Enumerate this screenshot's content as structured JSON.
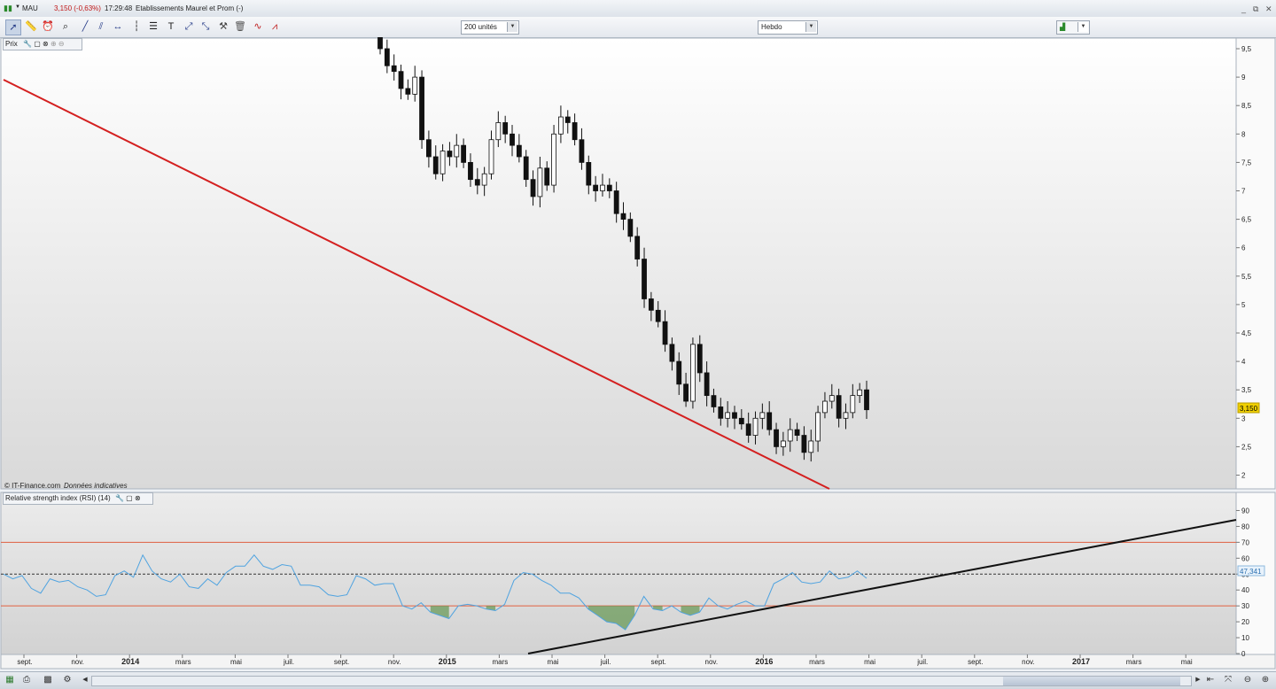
{
  "header": {
    "ticker": "MAU",
    "price_change": "3,150 (-0,63%)",
    "time": "17:29:48",
    "company": "Etablissements Maurel et Prom (-)"
  },
  "toolbar": {
    "units_select": "200 unités",
    "period_select": "Hebdo",
    "icons": [
      "cursor-icon",
      "ruler-icon",
      "alarm-icon",
      "zoom-icon",
      "trendline-icon",
      "channel-icon",
      "horizontal-line-icon",
      "vertical-line-icon",
      "text-icon",
      "fibonacci-icon",
      "arrow-icon",
      "tools-icon",
      "delete-icon",
      "wave-icon",
      "pattern-icon"
    ]
  },
  "price_panel": {
    "label": "Prix",
    "credit": "© IT-Finance.com",
    "credit_note": "Données indicatives",
    "last_price_tag": "3,150",
    "yticks": [
      "9,5",
      "9",
      "8,5",
      "8",
      "7,5",
      "7",
      "6,5",
      "6",
      "5,5",
      "5",
      "4,5",
      "4",
      "3,5",
      "3",
      "2,5",
      "2"
    ]
  },
  "rsi_panel": {
    "label": "Relative strength index (RSI) (14)",
    "yticks": [
      "90",
      "80",
      "70",
      "60",
      "50",
      "40",
      "30",
      "20",
      "10",
      "0"
    ],
    "last_value_tag": "47,341",
    "upper_level": 70,
    "lower_level": 30,
    "mid_level": 50,
    "line_color": "#4fa3e0",
    "fill_color": "#6a9a58"
  },
  "xaxis": {
    "labels": [
      "sept.",
      "nov.",
      "2014",
      "mars",
      "mai",
      "juil.",
      "sept.",
      "nov.",
      "2015",
      "mars",
      "mai",
      "juil.",
      "sept.",
      "nov.",
      "2016",
      "mars",
      "mai",
      "juil.",
      "sept.",
      "nov.",
      "2017",
      "mars",
      "mai"
    ],
    "bold": [
      "2014",
      "2015",
      "2016",
      "2017"
    ]
  },
  "colors": {
    "resistance": "#d42020",
    "support": "#111111",
    "level_line": "#e06040",
    "tag": "#f0d000"
  },
  "chart_data": [
    {
      "type": "candlestick",
      "title": "Prix",
      "timeframe": "weekly",
      "ylim": [
        1.8,
        9.7
      ],
      "last": 3.15,
      "weekly_close_approx": [
        9.5,
        9.2,
        9.1,
        8.8,
        8.7,
        9.0,
        7.9,
        7.6,
        7.3,
        7.7,
        7.6,
        7.8,
        7.5,
        7.2,
        7.1,
        7.3,
        7.9,
        8.2,
        8.0,
        7.8,
        7.6,
        7.2,
        6.9,
        7.4,
        7.1,
        8.0,
        8.3,
        8.2,
        7.9,
        7.5,
        7.1,
        7.0,
        7.1,
        7.0,
        6.6,
        6.5,
        6.2,
        5.8,
        5.1,
        4.9,
        4.7,
        4.3,
        4.0,
        3.6,
        3.3,
        4.3,
        3.8,
        3.4,
        3.2,
        3.0,
        3.1,
        3.0,
        2.9,
        2.7,
        3.0,
        3.1,
        2.8,
        2.5,
        2.6,
        2.8,
        2.7,
        2.4,
        2.6,
        3.1,
        3.3,
        3.4,
        3.0,
        3.1,
        3.4,
        3.5,
        3.15
      ],
      "trendlines": [
        {
          "kind": "resistance",
          "color": "#d42020"
        }
      ]
    },
    {
      "type": "line",
      "title": "Relative strength index (RSI) (14)",
      "ylim": [
        0,
        95
      ],
      "levels": [
        30,
        50,
        70
      ],
      "values": [
        50,
        47,
        49,
        41,
        38,
        47,
        45,
        46,
        42,
        40,
        36,
        37,
        49,
        52,
        48,
        62,
        52,
        47,
        45,
        50,
        42,
        41,
        47,
        43,
        51,
        55,
        55,
        62,
        55,
        53,
        56,
        55,
        43,
        43,
        42,
        37,
        36,
        37,
        49,
        47,
        43,
        44,
        44,
        30,
        28,
        32,
        26,
        24,
        22,
        30,
        31,
        30,
        28,
        27,
        31,
        46,
        51,
        50,
        46,
        43,
        38,
        38,
        35,
        28,
        24,
        20,
        19,
        15,
        24,
        36,
        28,
        27,
        30,
        26,
        24,
        26,
        35,
        30,
        28,
        31,
        33,
        30,
        30,
        44,
        47,
        51,
        45,
        44,
        45,
        52,
        47,
        48,
        52,
        47.341
      ],
      "trendlines": [
        {
          "kind": "support",
          "color": "#111111"
        }
      ]
    }
  ]
}
